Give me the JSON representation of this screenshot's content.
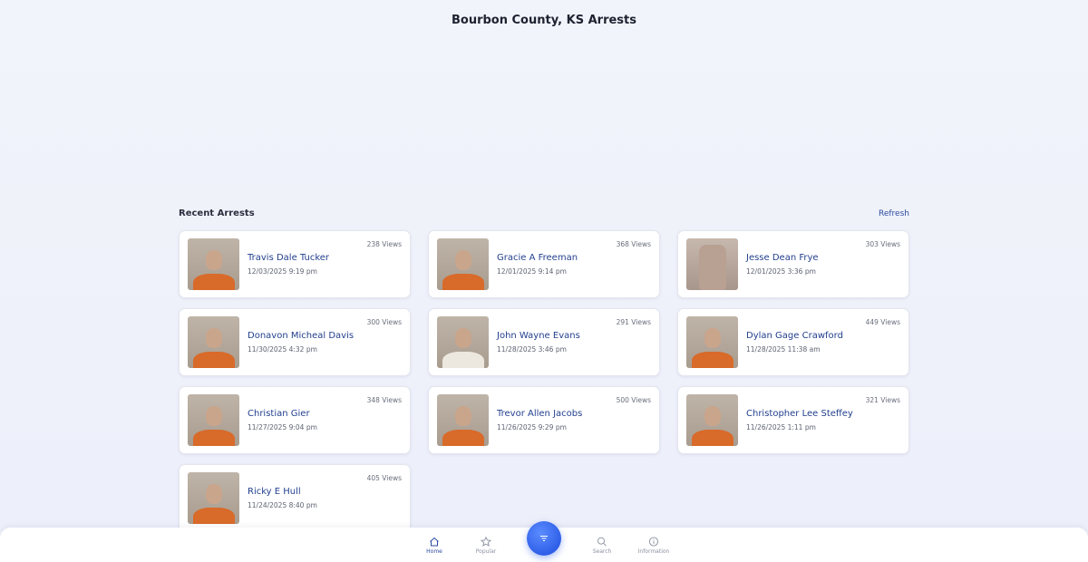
{
  "header": {
    "title": "Bourbon County, KS Arrests"
  },
  "section": {
    "title": "Recent Arrests",
    "refresh_label": "Refresh"
  },
  "arrests": [
    {
      "name": "Travis Dale Tucker",
      "date": "12/03/2025 9:19 pm",
      "views": "238 Views",
      "photo_icon": "mugshot"
    },
    {
      "name": "Gracie A Freeman",
      "date": "12/01/2025 9:14 pm",
      "views": "368 Views",
      "photo_icon": "mugshot"
    },
    {
      "name": "Jesse Dean Frye",
      "date": "12/01/2025 3:36 pm",
      "views": "303 Views",
      "photo_icon": "hand-photo"
    },
    {
      "name": "Donavon Micheal Davis",
      "date": "11/30/2025 4:32 pm",
      "views": "300 Views",
      "photo_icon": "mugshot"
    },
    {
      "name": "John Wayne Evans",
      "date": "11/28/2025 3:46 pm",
      "views": "291 Views",
      "photo_icon": "mugshot"
    },
    {
      "name": "Dylan Gage Crawford",
      "date": "11/28/2025 11:38 am",
      "views": "449 Views",
      "photo_icon": "mugshot"
    },
    {
      "name": "Christian Gier",
      "date": "11/27/2025 9:04 pm",
      "views": "348 Views",
      "photo_icon": "mugshot"
    },
    {
      "name": "Trevor Allen Jacobs",
      "date": "11/26/2025 9:29 pm",
      "views": "500 Views",
      "photo_icon": "mugshot"
    },
    {
      "name": "Christopher Lee Steffey",
      "date": "11/26/2025 1:11 pm",
      "views": "321 Views",
      "photo_icon": "mugshot"
    },
    {
      "name": "Ricky E Hull",
      "date": "11/24/2025 8:40 pm",
      "views": "405 Views",
      "photo_icon": "mugshot"
    }
  ],
  "nav": {
    "home": "Home",
    "popular": "Popular",
    "search": "Search",
    "information": "Information",
    "active": "home"
  },
  "colors": {
    "accent": "#2c4aa0",
    "fab": "#2f5fe8",
    "jumpsuit": "#d86a2a"
  }
}
